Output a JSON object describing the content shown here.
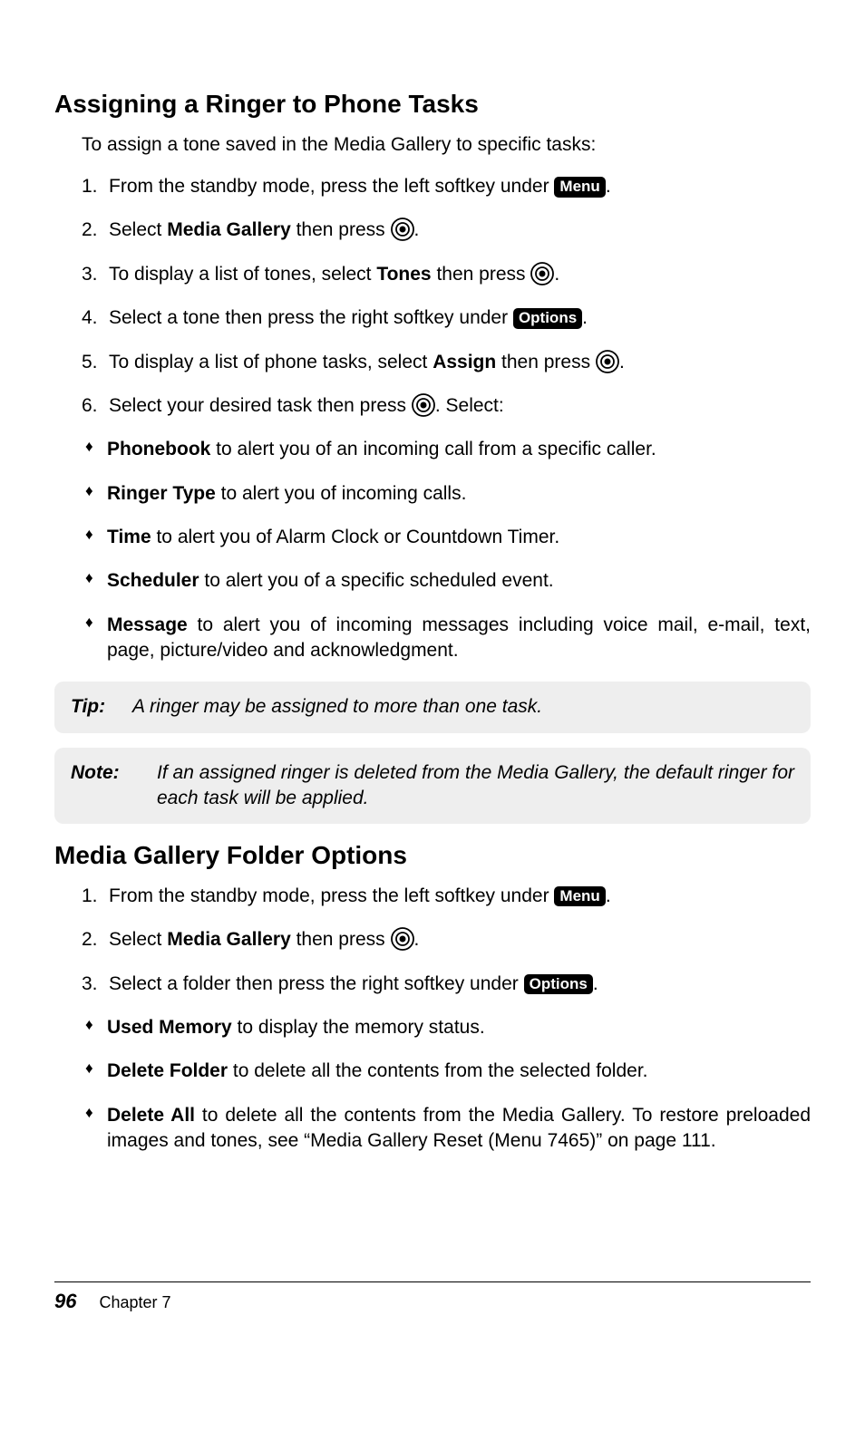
{
  "section1": {
    "heading": "Assigning a Ringer to Phone Tasks",
    "intro": "To assign a tone saved in the Media Gallery to specific tasks:",
    "steps": {
      "s1a": "From the standby mode, press the left softkey under ",
      "s1key": "Menu",
      "s1b": ".",
      "s2a": "Select ",
      "s2bold": "Media Gallery",
      "s2b": " then press ",
      "s2c": ".",
      "s3a": "To display a list of tones, select ",
      "s3bold": "Tones",
      "s3b": " then press ",
      "s3c": ".",
      "s4a": "Select a tone then press the right softkey under ",
      "s4key": "Options",
      "s4b": ".",
      "s5a": "To display a list of phone tasks, select ",
      "s5bold": "Assign",
      "s5b": " then press ",
      "s5c": ".",
      "s6a": "Select your desired task then press ",
      "s6b": ". Select:"
    },
    "bullets": {
      "b1bold": "Phonebook",
      "b1txt": " to alert you of an incoming call from a specific caller.",
      "b2bold": "Ringer Type",
      "b2txt": " to alert you of incoming calls.",
      "b3bold": "Time",
      "b3txt": " to alert you of Alarm Clock or Countdown Timer.",
      "b4bold": "Scheduler",
      "b4txt": " to alert you of a specific scheduled event.",
      "b5bold": "Message",
      "b5txt": " to alert you of incoming messages including voice mail, e-mail, text, page, picture/video and acknowledgment."
    },
    "tip": {
      "label": "Tip:",
      "text": "A ringer may be assigned to more than one task."
    },
    "note": {
      "label": "Note:",
      "text": "If an assigned ringer is deleted from the Media Gallery, the default ringer for each task will be applied."
    }
  },
  "section2": {
    "heading": "Media Gallery Folder Options",
    "steps": {
      "s1a": "From the standby mode, press the left softkey under ",
      "s1key": "Menu",
      "s1b": ".",
      "s2a": "Select ",
      "s2bold": "Media Gallery",
      "s2b": " then press ",
      "s2c": ".",
      "s3a": "Select a folder then press the right softkey under ",
      "s3key": "Options",
      "s3b": "."
    },
    "bullets": {
      "b1bold": "Used Memory",
      "b1txt": " to display the memory status.",
      "b2bold": "Delete Folder",
      "b2txt": " to delete all the contents from the selected folder.",
      "b3bold": "Delete All",
      "b3txt": " to delete all the contents from the Media Gallery. To restore preloaded images and tones, see “Media Gallery Reset (Menu 7465)” on page 111."
    }
  },
  "footer": {
    "page": "96",
    "chapter": "Chapter 7"
  }
}
